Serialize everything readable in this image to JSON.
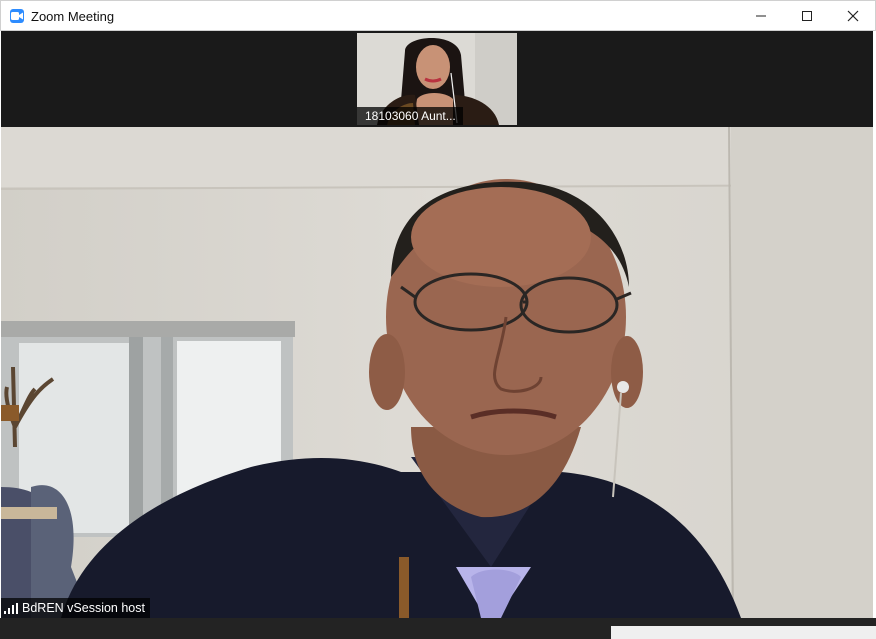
{
  "window": {
    "title": "Zoom Meeting",
    "controls": {
      "minimize": "minimize-icon",
      "maximize": "maximize-icon",
      "close": "close-icon"
    }
  },
  "participants_strip": {
    "thumbnail": {
      "label": "18103060 Aunt..."
    }
  },
  "active_speaker": {
    "name_label": "BdREN vSession host",
    "signal_icon": "signal-strength-icon"
  },
  "colors": {
    "accent": "#2d8cff",
    "strip_background": "#1a1a1a",
    "label_background": "#000000"
  }
}
